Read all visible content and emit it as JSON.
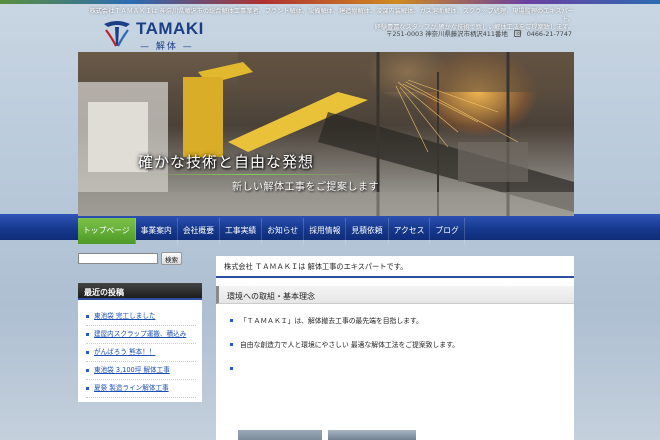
{
  "header": {
    "logo_text": "TAMAKI",
    "logo_sub": "解体",
    "description_line1": "株式会社ＴＡＭＡＫＩは 神奈川県藤沢市の総合解体工事業者。プラント解体、設備解体、建造物解体、浚渫内装解体、ガス溶断解体、スクラップ処理、現場監理のエキスパート。",
    "description_line2": "経験豊富なスタッフが 確かな技術で新しい解体工法をご提案致します。",
    "address": "〒251-0003 神奈川県藤沢市柄沢411番地",
    "phone": "0466-21-7747"
  },
  "hero": {
    "catch": "確かな技術と自由な発想",
    "sub": "新しい解体工事をご提案します"
  },
  "nav": {
    "items": [
      "トップページ",
      "事業案内",
      "会社概要",
      "工事実績",
      "お知らせ",
      "採用情報",
      "見積依頼",
      "アクセス",
      "ブログ"
    ]
  },
  "sidebar": {
    "search_button": "検索",
    "recent_title": "最近の投稿",
    "recent_posts": [
      "東池袋 完工しました",
      "建屋内スクラップ運搬、積込み",
      "がんばろう 熊本！！",
      "東池袋 3,100坪 解体工事",
      "夏祭 製造ライン解体工事"
    ]
  },
  "main": {
    "intro": "株式会社 ＴＡＭＡＫＩは 解体工事のエキスパートです。",
    "section_title": "環境への取組・基本理念",
    "items": [
      "「ＴＡＭＡＫＩ」は、解体撤去工事の最先端を目指します。",
      "自由な創造力で人と環境にやさしい 最適な解体工法をご提案致します。",
      ""
    ]
  },
  "colors": {
    "nav_bg": "#173a8f",
    "nav_active": "#4d9a26",
    "link": "#1a4fb3",
    "logo": "#1b3f87"
  }
}
